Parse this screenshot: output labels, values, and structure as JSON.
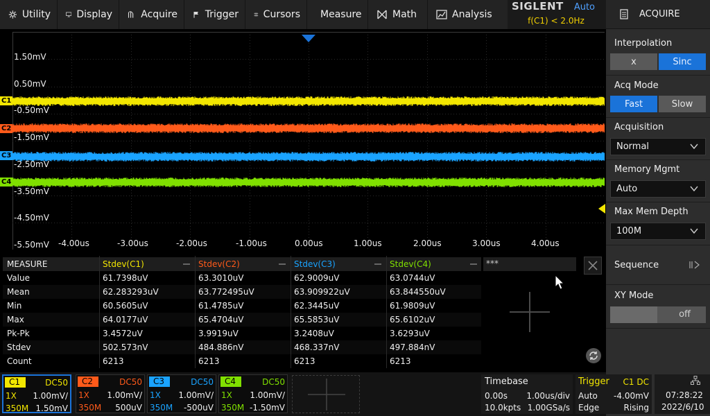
{
  "menu": [
    {
      "label": "Utility",
      "icon": "gear-icon"
    },
    {
      "label": "Display",
      "icon": "monitor-icon"
    },
    {
      "label": "Acquire",
      "icon": "acquire-icon"
    },
    {
      "label": "Trigger",
      "icon": "flag-icon"
    },
    {
      "label": "Cursors",
      "icon": "cursors-icon"
    },
    {
      "label": "Measure",
      "icon": "measure-icon"
    },
    {
      "label": "Math",
      "icon": "math-icon"
    },
    {
      "label": "Analysis",
      "icon": "analysis-icon"
    }
  ],
  "brand": {
    "logo": "SIGLENT",
    "mode": "Auto",
    "freq": "f(C1) < 2.0Hz"
  },
  "panel": {
    "title": "ACQUIRE",
    "interpolation": {
      "label": "Interpolation",
      "options": [
        "x",
        "Sinc"
      ],
      "selected": "Sinc"
    },
    "acq_mode": {
      "label": "Acq Mode",
      "options": [
        "Fast",
        "Slow"
      ],
      "selected": "Fast"
    },
    "acquisition": {
      "label": "Acquisition",
      "value": "Normal"
    },
    "memory_mgmt": {
      "label": "Memory Mgmt",
      "value": "Auto"
    },
    "max_mem_depth": {
      "label": "Max Mem Depth",
      "value": "100M"
    },
    "sequence": {
      "label": "Sequence"
    },
    "xy_mode": {
      "label": "XY Mode",
      "value": "off"
    }
  },
  "waveform": {
    "voltage_labels": [
      "1.50mV",
      "0.50mV",
      "-0.50mV",
      "-1.50mV",
      "-2.50mV",
      "-3.50mV",
      "-4.50mV",
      "-5.50mV"
    ],
    "time_labels": [
      "-4.00us",
      "-3.00us",
      "-2.00us",
      "-1.00us",
      "0.00us",
      "1.00us",
      "2.00us",
      "3.00us",
      "4.00us"
    ],
    "channels": [
      {
        "name": "C1",
        "color": "#f2e600"
      },
      {
        "name": "C2",
        "color": "#ff5a1a"
      },
      {
        "name": "C3",
        "color": "#1aa3ff"
      },
      {
        "name": "C4",
        "color": "#80e000"
      }
    ]
  },
  "measure": {
    "title": "MEASURE",
    "columns": [
      "Stdev(C1)",
      "Stdev(C2)",
      "Stdev(C3)",
      "Stdev(C4)",
      "***"
    ],
    "rows": [
      {
        "label": "Value",
        "vals": [
          "61.7398uV",
          "63.3010uV",
          "62.9009uV",
          "63.0744uV"
        ]
      },
      {
        "label": "Mean",
        "vals": [
          "62.283293uV",
          "63.772495uV",
          "63.909922uV",
          "63.844550uV"
        ]
      },
      {
        "label": "Min",
        "vals": [
          "60.5605uV",
          "61.4785uV",
          "62.3445uV",
          "61.9809uV"
        ]
      },
      {
        "label": "Max",
        "vals": [
          "64.0177uV",
          "65.4704uV",
          "65.5853uV",
          "65.6102uV"
        ]
      },
      {
        "label": "Pk-Pk",
        "vals": [
          "3.4572uV",
          "3.9919uV",
          "3.2408uV",
          "3.6293uV"
        ]
      },
      {
        "label": "Stdev",
        "vals": [
          "502.573nV",
          "484.886nV",
          "468.337nV",
          "497.884nV"
        ]
      },
      {
        "label": "Count",
        "vals": [
          "6213",
          "6213",
          "6213",
          "6213"
        ]
      }
    ]
  },
  "channel_boxes": [
    {
      "name": "C1",
      "coupling": "DC50",
      "probe": "1X",
      "scale": "1.00mV/",
      "bw": "350M",
      "offset": "1.50mV"
    },
    {
      "name": "C2",
      "coupling": "DC50",
      "probe": "1X",
      "scale": "1.00mV/",
      "bw": "350M",
      "offset": "500uV"
    },
    {
      "name": "C3",
      "coupling": "DC50",
      "probe": "1X",
      "scale": "1.00mV/",
      "bw": "350M",
      "offset": "-500uV"
    },
    {
      "name": "C4",
      "coupling": "DC50",
      "probe": "1X",
      "scale": "1.00mV/",
      "bw": "350M",
      "offset": "-1.50mV"
    }
  ],
  "timebase": {
    "title": "Timebase",
    "delay": "0.00s",
    "scale": "1.00us/div",
    "points": "10.0kpts",
    "rate": "1.00GSa/s"
  },
  "trigger": {
    "title": "Trigger",
    "source": "C1 DC",
    "mode": "Auto",
    "level": "-4.00mV",
    "type": "Edge",
    "slope": "Rising"
  },
  "clock": {
    "time": "07:28:22",
    "date": "2022/6/10"
  }
}
